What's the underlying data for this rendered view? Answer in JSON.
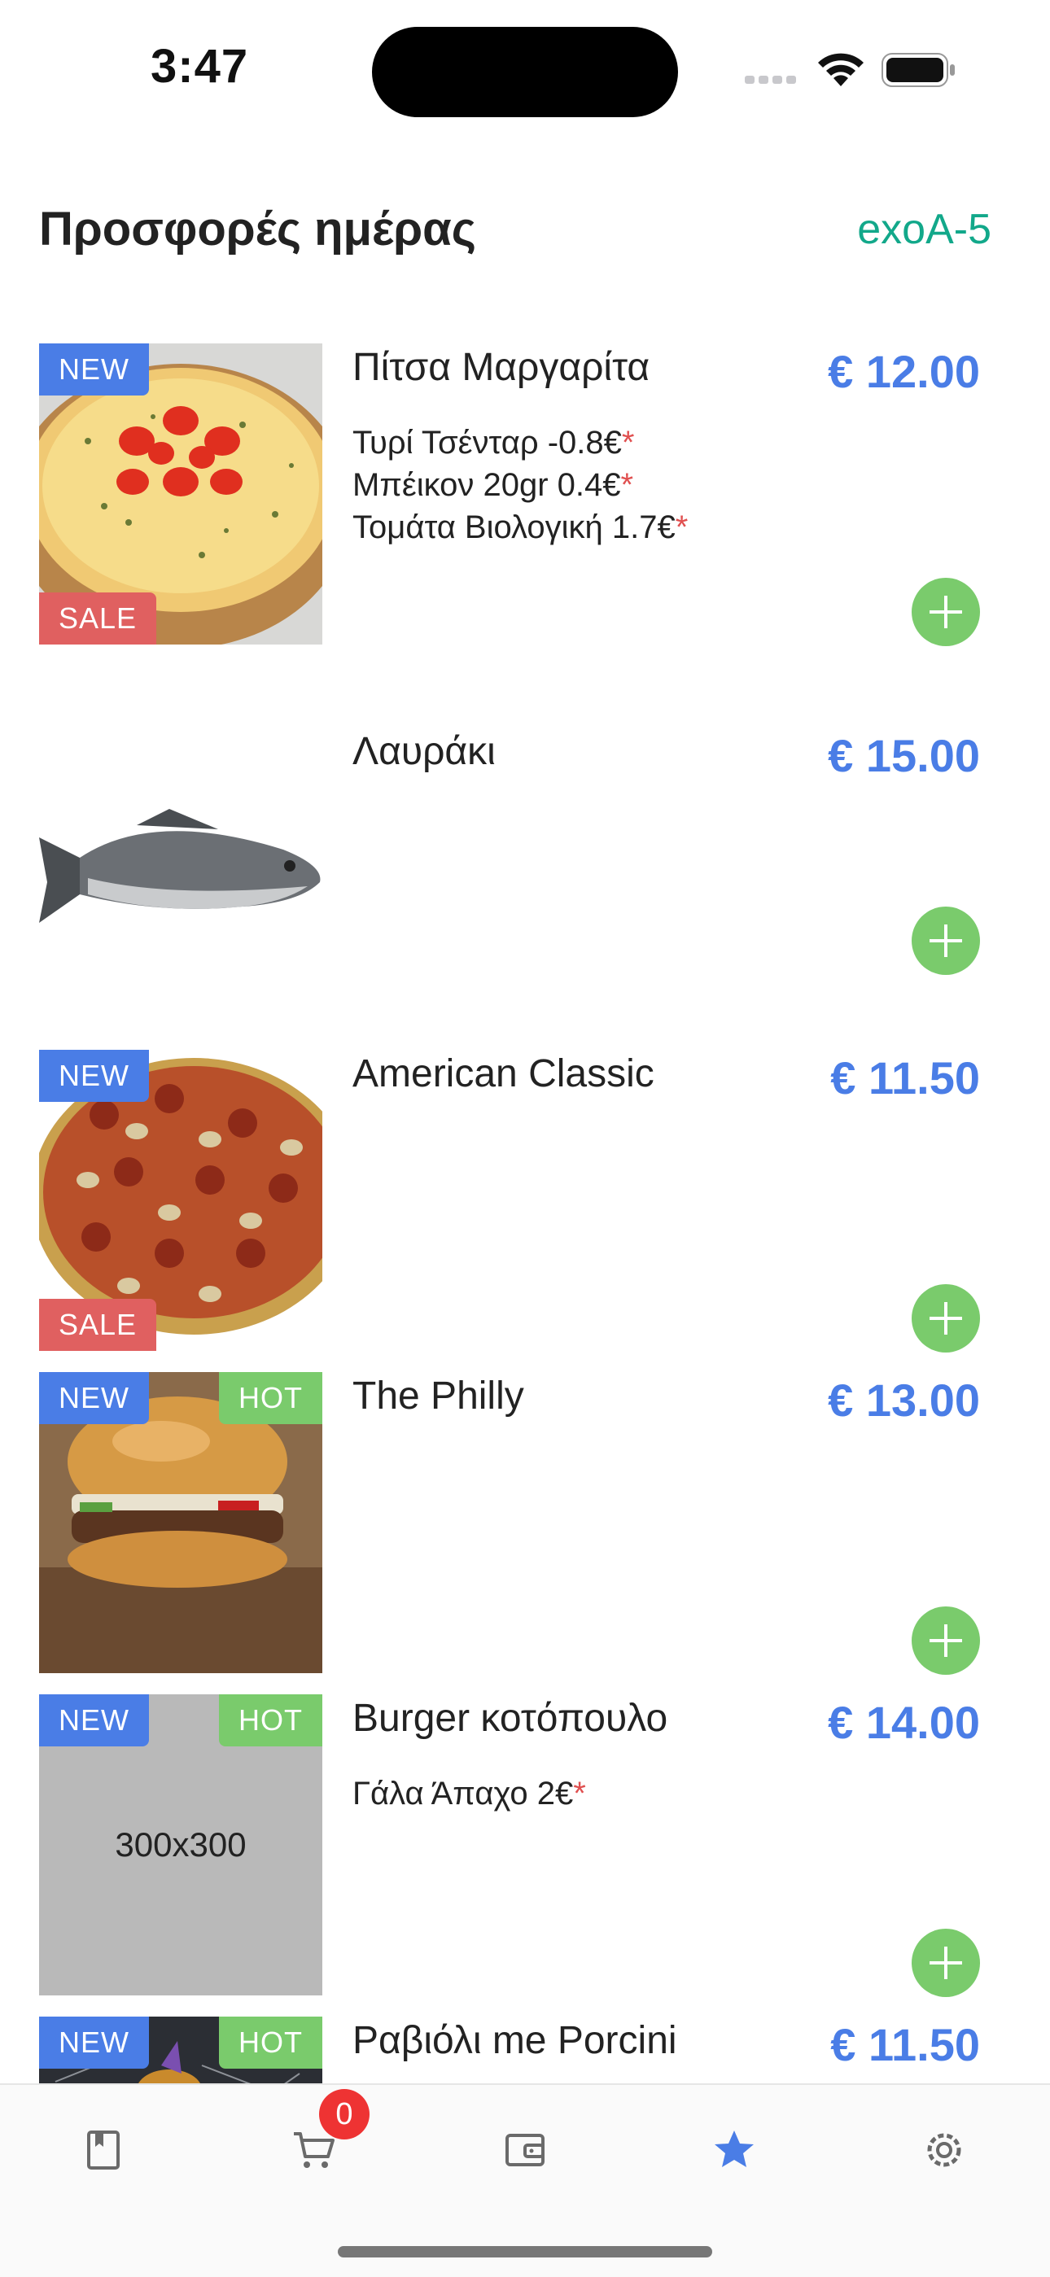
{
  "status": {
    "time": "3:47"
  },
  "header": {
    "title": "Προσφορές ημέρας",
    "table_code": "exoA-5"
  },
  "colors": {
    "accent_blue": "#4a7de6",
    "green": "#7acb6c",
    "sale_red": "#e06060",
    "teal": "#12a88a"
  },
  "items": [
    {
      "name": "Πίτσα Μαργαρίτα",
      "price": "€ 12.00",
      "badges": {
        "new": "NEW",
        "sale": "SALE"
      },
      "extras": [
        "Τυρί Τσένταρ -0.8€",
        "Μπέικον 20gr 0.4€",
        "Τομάτα Βιολογική 1.7€"
      ],
      "extra_mark": "*"
    },
    {
      "name": "Λαυράκι",
      "price": "€ 15.00"
    },
    {
      "name": "American Classic",
      "price": "€ 11.50",
      "badges": {
        "new": "NEW",
        "sale": "SALE"
      }
    },
    {
      "name": "The Philly",
      "price": "€ 13.00",
      "badges": {
        "new": "NEW",
        "hot": "HOT"
      }
    },
    {
      "name": "Burger κοτόπουλο",
      "price": "€ 14.00",
      "badges": {
        "new": "NEW",
        "hot": "HOT"
      },
      "placeholder": "300x300",
      "extras": [
        "Γάλα Άπαχο 2€"
      ],
      "extra_mark": "*"
    },
    {
      "name": "Ραβιόλι me Porcini",
      "price": "€ 11.50",
      "badges": {
        "new": "NEW",
        "hot": "HOT"
      }
    }
  ],
  "tab_bar": {
    "tabs": [
      "menu-book-icon",
      "cart-icon",
      "wallet-icon",
      "star-icon",
      "settings-icon"
    ],
    "cart_count": "0",
    "active": "star-icon"
  }
}
